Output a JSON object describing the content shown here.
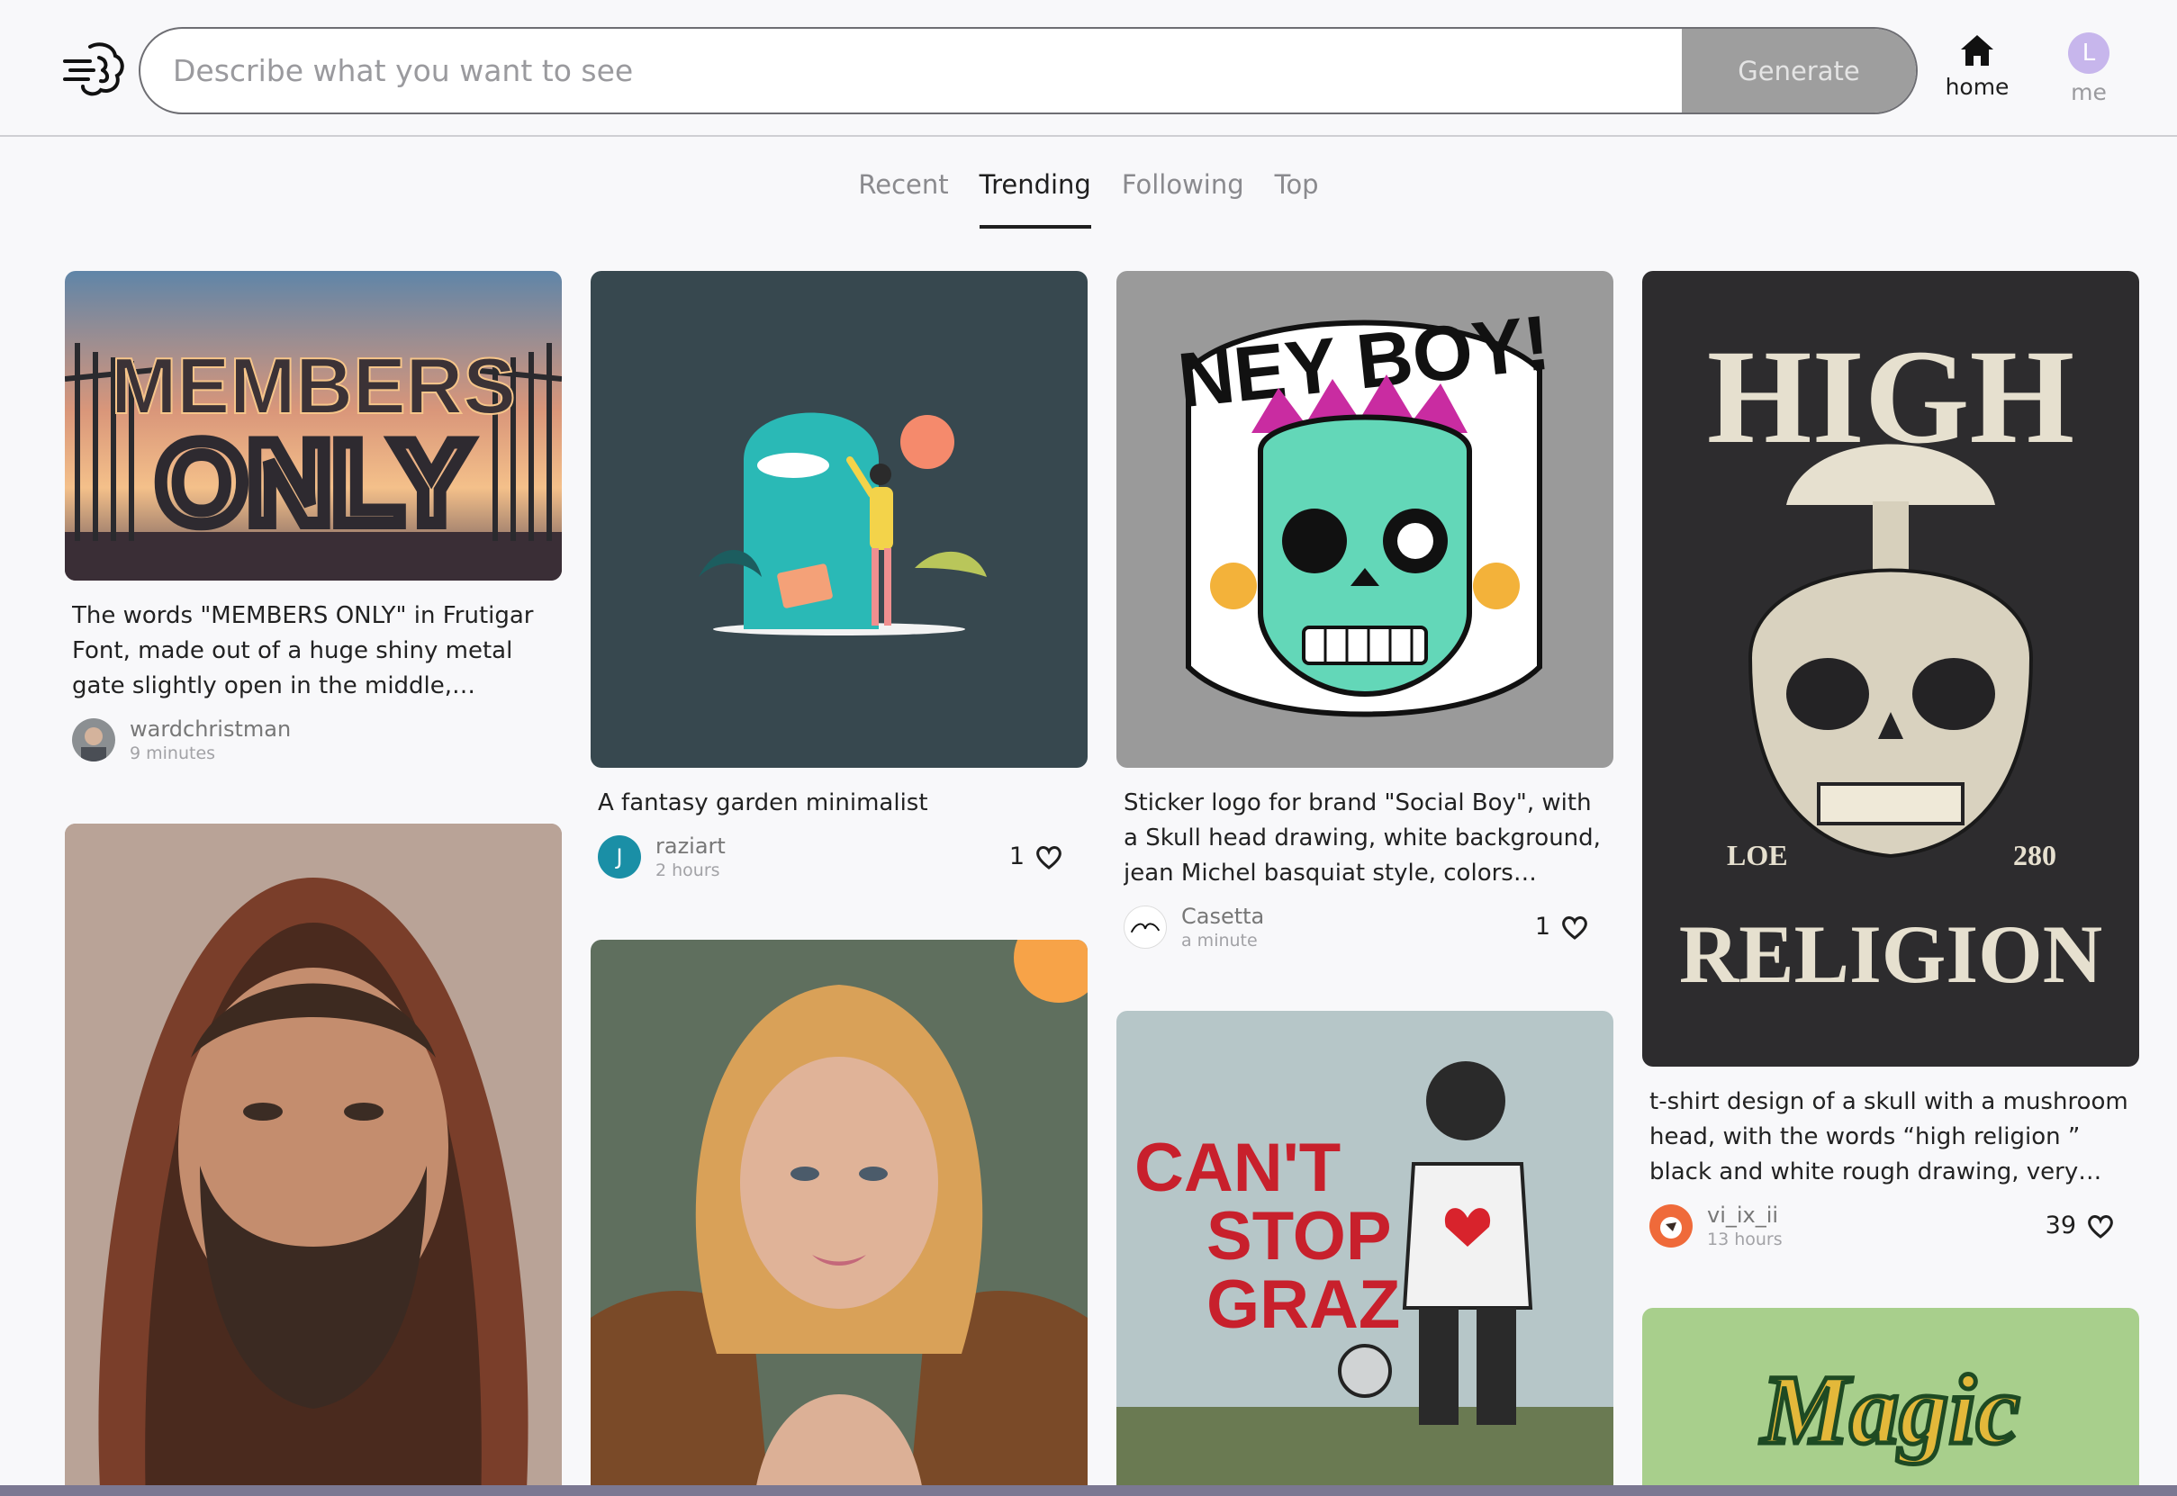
{
  "search": {
    "placeholder": "Describe what you want to see",
    "button_label": "Generate"
  },
  "nav": {
    "home_label": "home",
    "me_label": "me",
    "me_initial": "L"
  },
  "tabs": [
    {
      "label": "Recent",
      "active": false
    },
    {
      "label": "Trending",
      "active": true
    },
    {
      "label": "Following",
      "active": false
    },
    {
      "label": "Top",
      "active": false
    }
  ],
  "cards": [
    {
      "image_text": [
        "MEMBERS",
        "ONLY"
      ],
      "caption": "The words \"MEMBERS ONLY\" in Frutigar Font, made out of a huge shiny metal gate slightly open in the middle, sunrise...",
      "user": "wardchristman",
      "time": "9 minutes"
    },
    {
      "caption": "A fantasy garden minimalist",
      "user": "raziart",
      "user_initial": "J",
      "time": "2 hours",
      "likes": "1"
    },
    {
      "image_text": [
        "NEY BOY!"
      ],
      "caption": "Sticker logo for brand \"Social Boy\", with a Skull head drawing, white background, jean Michel basquiat style, colors purple,...",
      "user": "Casetta",
      "time": "a minute",
      "likes": "1"
    },
    {
      "image_text": [
        "HIGH",
        "LOE",
        "280",
        "RELIGION"
      ],
      "caption": "t-shirt design of a skull with a mushroom head, with the words “high religion ” black and white rough drawing, very high...",
      "user": "vi_ix_ii",
      "time": "13 hours",
      "likes": "39"
    },
    {
      "image_text": [
        "CAN'T",
        "STOP",
        "GRAZ"
      ]
    },
    {
      "image_text": [
        "Magic"
      ]
    }
  ],
  "colors": {
    "accent": "#1f1f1f",
    "muted": "#8a8a8e",
    "generate_bg": "#9e9e9e",
    "avatar_me": "#c7b6ec",
    "avatar_raziart": "#1a8fa6"
  }
}
